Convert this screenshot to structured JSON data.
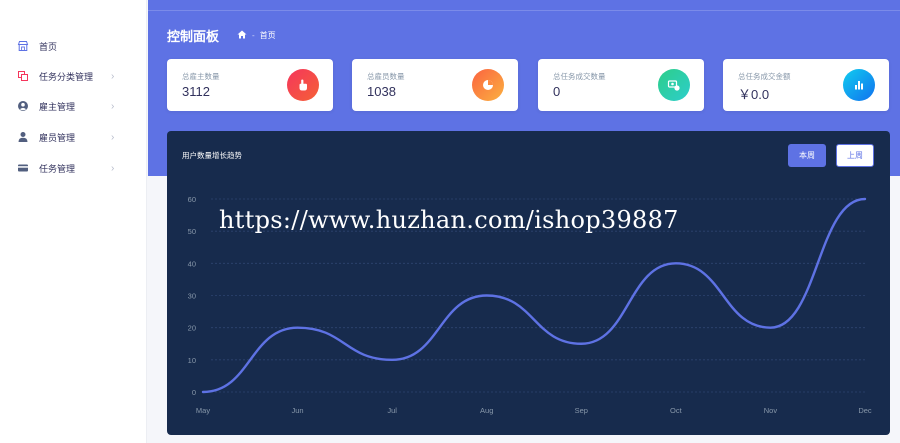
{
  "sidebar": {
    "items": [
      {
        "label": "首页",
        "icon": "storefront-icon",
        "has_chevron": false,
        "active": true
      },
      {
        "label": "任务分类管理",
        "icon": "copy-icon",
        "has_chevron": true
      },
      {
        "label": "雇主管理",
        "icon": "user-circle-icon",
        "has_chevron": true
      },
      {
        "label": "雇员管理",
        "icon": "person-icon",
        "has_chevron": true
      },
      {
        "label": "任务管理",
        "icon": "credit-card-icon",
        "has_chevron": true
      }
    ]
  },
  "header": {
    "title": "控制面板",
    "breadcrumb": {
      "home_icon": "home-icon",
      "separator": "-",
      "current": "首页"
    }
  },
  "cards": [
    {
      "label": "总雇主数量",
      "value": "3112",
      "icon": "hand-pointer-icon",
      "color": "#f5365c"
    },
    {
      "label": "总雇员数量",
      "value": "1038",
      "icon": "pie-chart-icon",
      "color": "#fb6340"
    },
    {
      "label": "总任务成交数量",
      "value": "0",
      "icon": "money-icon",
      "color": "#2dce89"
    },
    {
      "label": "总任务成交金额",
      "value": "￥0.0",
      "icon": "bar-chart-icon",
      "color": "#11cdef"
    }
  ],
  "panel": {
    "title": "用户数量增长趋势",
    "buttons": {
      "this_week": "本周",
      "last_week": "上周"
    }
  },
  "watermark": "https://www.huzhan.com/ishop39887",
  "chart_data": {
    "type": "line",
    "categories": [
      "May",
      "Jun",
      "Jul",
      "Aug",
      "Sep",
      "Oct",
      "Nov",
      "Dec"
    ],
    "series": [
      {
        "values": [
          0,
          20,
          10,
          30,
          15,
          40,
          20,
          60
        ]
      }
    ],
    "ylim": [
      0,
      60
    ],
    "yticks": [
      0,
      10,
      20,
      30,
      40,
      50,
      60
    ],
    "grid": true,
    "line_color": "#5e72e4"
  }
}
